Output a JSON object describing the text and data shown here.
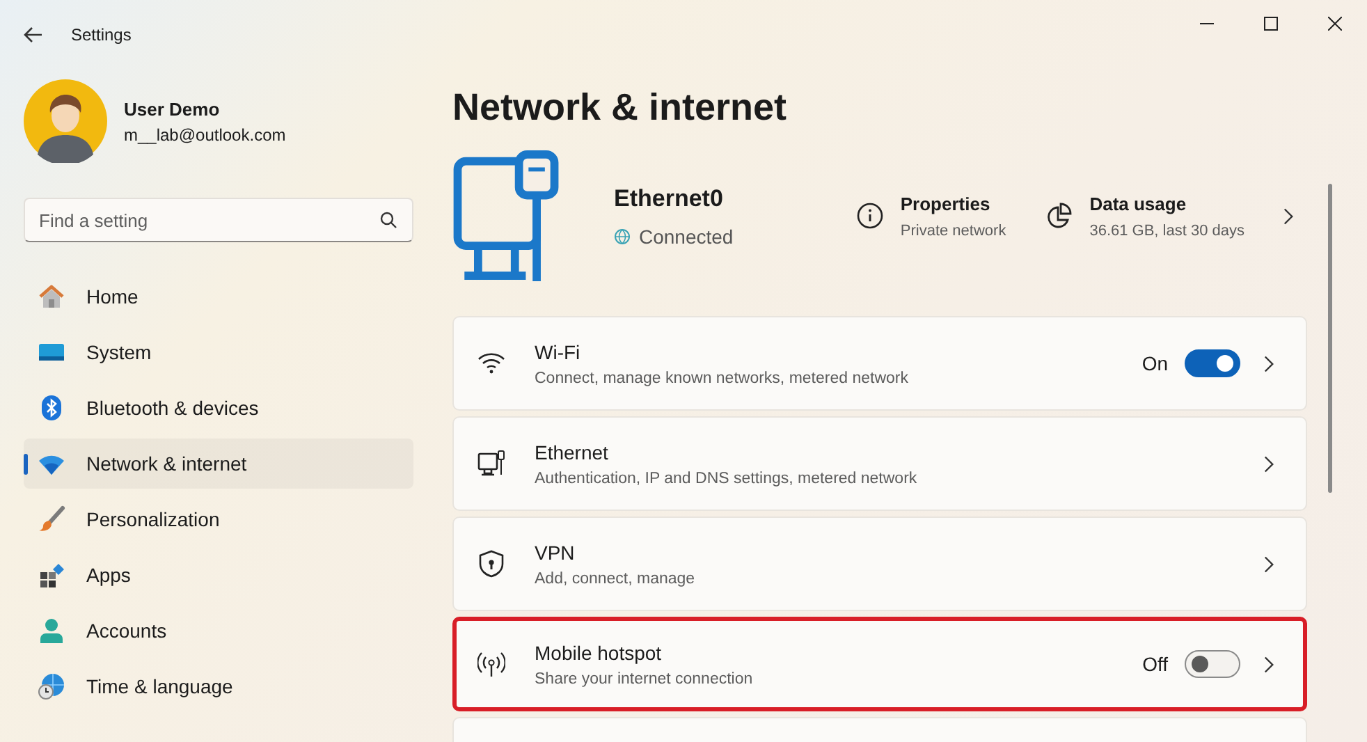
{
  "window": {
    "title": "Settings"
  },
  "account": {
    "name": "User Demo",
    "email": "m__lab@outlook.com"
  },
  "search": {
    "placeholder": "Find a setting"
  },
  "sidebar": {
    "items": [
      {
        "kind": "home",
        "label": "Home",
        "selected": false
      },
      {
        "kind": "system",
        "label": "System",
        "selected": false
      },
      {
        "kind": "bluetooth",
        "label": "Bluetooth & devices",
        "selected": false
      },
      {
        "kind": "network",
        "label": "Network & internet",
        "selected": true
      },
      {
        "kind": "brush",
        "label": "Personalization",
        "selected": false
      },
      {
        "kind": "apps",
        "label": "Apps",
        "selected": false
      },
      {
        "kind": "accounts",
        "label": "Accounts",
        "selected": false
      },
      {
        "kind": "time",
        "label": "Time & language",
        "selected": false
      }
    ]
  },
  "page": {
    "title": "Network & internet"
  },
  "connection": {
    "name": "Ethernet0",
    "status": "Connected",
    "properties": {
      "label": "Properties",
      "detail": "Private network"
    },
    "data_usage": {
      "label": "Data usage",
      "detail": "36.61 GB, last 30 days"
    }
  },
  "settings": [
    {
      "kind": "wifi",
      "title": "Wi-Fi",
      "description": "Connect, manage known networks, metered network",
      "toggle": {
        "on": true,
        "label": "On"
      },
      "highlighted": false
    },
    {
      "kind": "ethernet",
      "title": "Ethernet",
      "description": "Authentication, IP and DNS settings, metered network",
      "highlighted": false
    },
    {
      "kind": "vpn",
      "title": "VPN",
      "description": "Add, connect, manage",
      "highlighted": false
    },
    {
      "kind": "hotspot",
      "title": "Mobile hotspot",
      "description": "Share your internet connection",
      "toggle": {
        "on": false,
        "label": "Off"
      },
      "highlighted": true
    }
  ]
}
